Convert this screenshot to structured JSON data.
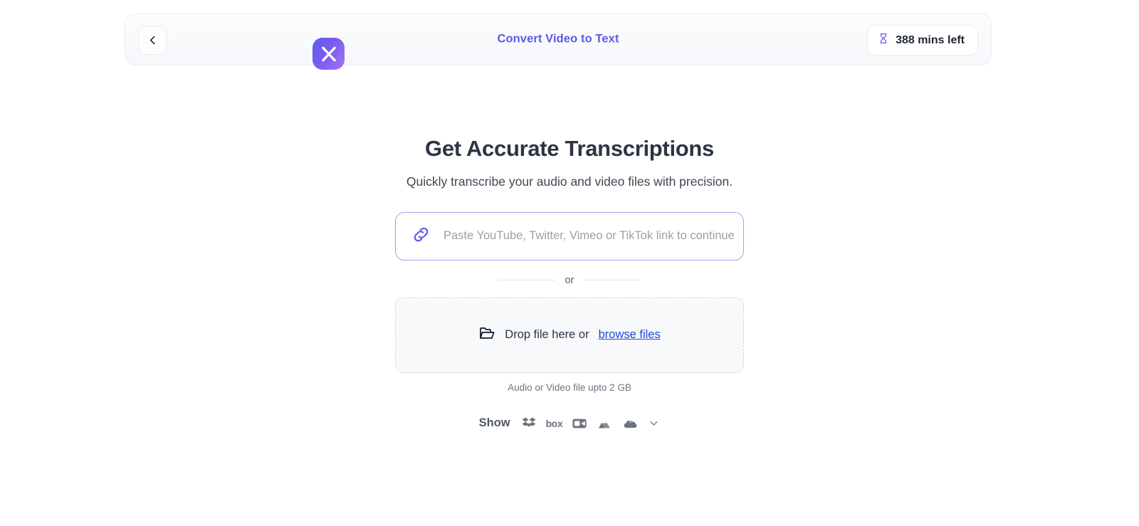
{
  "header": {
    "back_button": "back-chevron",
    "logo_letter": "X",
    "title": "Convert Video to Text",
    "credit": {
      "icon": "hourglass-icon",
      "label": "388 mins left"
    }
  },
  "main": {
    "headline": "Get Accurate Transcriptions",
    "subhead": "Quickly transcribe your audio and video files with precision.",
    "url_input": {
      "icon": "link-icon",
      "value": "",
      "placeholder": "Paste YouTube, Twitter, Vimeo or TikTok link to continue"
    },
    "divider_label": "or",
    "dropzone": {
      "icon": "open-folder-icon",
      "text": "Drop file here or",
      "browse_link": "browse files"
    },
    "file_note": "Audio or Video file upto 2 GB",
    "cloud": {
      "show_label": "Show",
      "services": [
        {
          "name": "dropbox-icon",
          "label": ""
        },
        {
          "name": "box-icon",
          "label": "box"
        },
        {
          "name": "zoom-icon",
          "label": ""
        },
        {
          "name": "google-drive-icon",
          "label": ""
        },
        {
          "name": "onedrive-icon",
          "label": ""
        }
      ],
      "more": "chevron-down-icon"
    }
  },
  "colors": {
    "brand_purple": "#5b5be6",
    "link_blue": "#1c47d6",
    "heading": "#2c3545",
    "muted": "#6d7584",
    "icon_gray": "#6b7280"
  }
}
